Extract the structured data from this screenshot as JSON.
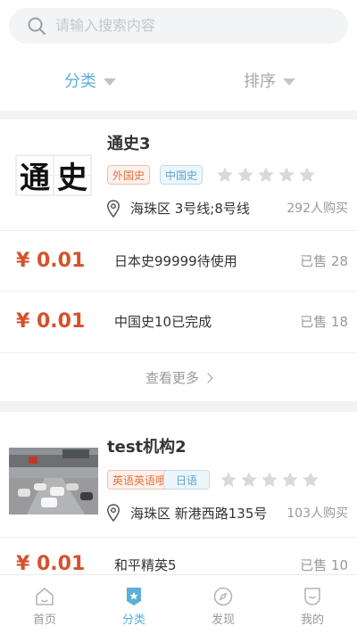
{
  "search": {
    "placeholder": "请输入搜索内容"
  },
  "filters": {
    "category": "分类",
    "sort": "排序"
  },
  "institutions": [
    {
      "name": "通史3",
      "thumb_text": "通史",
      "tags": [
        "外国史",
        "中国史"
      ],
      "rating": 0,
      "address": "海珠区 3号线;8号线",
      "buyers": "292人购买",
      "products": [
        {
          "price": "¥ 0.01",
          "name": "日本史99999待使用",
          "sold": "已售 28"
        },
        {
          "price": "¥ 0.01",
          "name": "中国史10已完成",
          "sold": "已售 18"
        }
      ],
      "more": "查看更多"
    },
    {
      "name": "test机构2",
      "tags": [
        "英语英语哦",
        "日语"
      ],
      "rating": 0,
      "address": "海珠区 新港西路135号",
      "buyers": "103人购买",
      "products": [
        {
          "price": "¥ 0.01",
          "name": "和平精英5",
          "sold": "已售 10"
        }
      ]
    }
  ],
  "tabbar": [
    {
      "label": "首页",
      "icon": "home-icon"
    },
    {
      "label": "分类",
      "icon": "category-icon",
      "active": true
    },
    {
      "label": "发现",
      "icon": "compass-icon"
    },
    {
      "label": "我的",
      "icon": "profile-icon"
    }
  ],
  "colors": {
    "accent": "#5ab0d8",
    "price": "#d6512b",
    "tag_orange": "#e0743f",
    "tag_blue": "#5aa5d4"
  }
}
